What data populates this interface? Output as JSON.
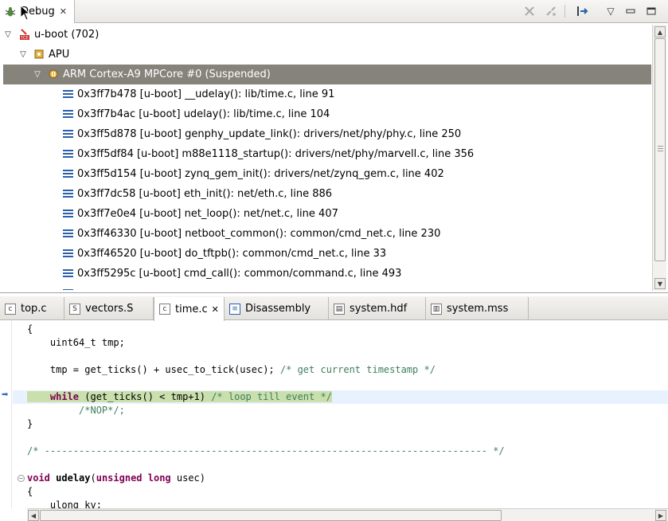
{
  "debug_view": {
    "tab_label": "Debug",
    "toolbar_icons": [
      "remove-all-terminated-icon",
      "disconnect-icon",
      "step-into-selection-icon",
      "view-menu-icon",
      "minimize-icon",
      "maximize-icon"
    ],
    "tree": {
      "launch": {
        "label": "u-boot (702)"
      },
      "group": {
        "label": "APU"
      },
      "thread": {
        "label": "ARM Cortex-A9 MPCore #0 (Suspended)"
      },
      "frames": [
        {
          "label": "0x3ff7b478 [u-boot] __udelay(): lib/time.c, line 91"
        },
        {
          "label": "0x3ff7b4ac [u-boot] udelay(): lib/time.c, line 104"
        },
        {
          "label": "0x3ff5d878 [u-boot] genphy_update_link(): drivers/net/phy/phy.c, line 250"
        },
        {
          "label": "0x3ff5df84 [u-boot] m88e1118_startup(): drivers/net/phy/marvell.c, line 356"
        },
        {
          "label": "0x3ff5d154 [u-boot] zynq_gem_init(): drivers/net/zynq_gem.c, line 402"
        },
        {
          "label": "0x3ff7dc58 [u-boot] eth_init(): net/eth.c, line 886"
        },
        {
          "label": "0x3ff7e0e4 [u-boot] net_loop(): net/net.c, line 407"
        },
        {
          "label": "0x3ff46330 [u-boot] netboot_common(): common/cmd_net.c, line 230"
        },
        {
          "label": "0x3ff46520 [u-boot] do_tftpb(): common/cmd_net.c, line 33"
        },
        {
          "label": "0x3ff5295c [u-boot] cmd_call(): common/command.c, line 493"
        }
      ]
    }
  },
  "editor": {
    "tabs": [
      {
        "label": "top.c",
        "icon": "c-file-icon"
      },
      {
        "label": "vectors.S",
        "icon": "asm-file-icon"
      },
      {
        "label": "time.c",
        "icon": "c-file-icon",
        "active": true
      },
      {
        "label": "Disassembly",
        "icon": "disassembly-icon"
      },
      {
        "label": "system.hdf",
        "icon": "hdf-file-icon"
      },
      {
        "label": "system.mss",
        "icon": "mss-file-icon"
      }
    ],
    "code": {
      "l1": "{",
      "l2": "    uint64_t tmp;",
      "l4a": "    tmp = get_ticks() + usec_to_tick(usec); ",
      "l4b": "/* get current timestamp */",
      "l6pre": "    ",
      "l6kw": "while",
      "l6mid": " (get_ticks() < tmp+1) ",
      "l6cm": "/* loop till event */",
      "l7": "         /*NOP*/;",
      "l8": "}",
      "l10": "/* ----------------------------------------------------------------------------- */",
      "l12kw1": "void",
      "l12name": " udelay",
      "l12p": "(",
      "l12kw2": "unsigned long",
      "l12rest": " usec)",
      "l13": "{",
      "l14": "    ulong kv;"
    }
  }
}
